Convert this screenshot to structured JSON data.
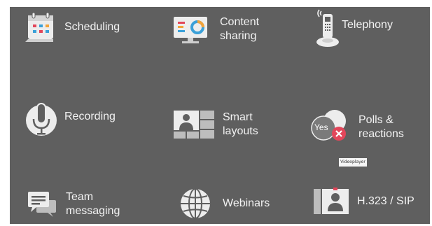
{
  "features": [
    {
      "id": "scheduling",
      "label": "Scheduling",
      "icon": "calendar-icon"
    },
    {
      "id": "content-sharing",
      "label": "Content\nsharing",
      "icon": "monitor-chart-icon"
    },
    {
      "id": "telephony",
      "label": "Telephony",
      "icon": "desk-phone-icon"
    },
    {
      "id": "recording",
      "label": "Recording",
      "icon": "microphone-icon"
    },
    {
      "id": "smart-layouts",
      "label": "Smart\nlayouts",
      "icon": "video-grid-icon"
    },
    {
      "id": "polls-reactions",
      "label": "Polls &\nreactions",
      "icon": "poll-bubble-icon",
      "icon_text": "Yes"
    },
    {
      "id": "team-messaging",
      "label": "Team\nmessaging",
      "icon": "chat-icon"
    },
    {
      "id": "webinars",
      "label": "Webinars",
      "icon": "globe-icon"
    },
    {
      "id": "h323-sip",
      "label": "H.323 / SIP",
      "icon": "conference-room-icon"
    }
  ],
  "badge_text": "Videoplayer",
  "colors": {
    "panel_bg": "#5f5f5f",
    "icon_light": "#ededed",
    "icon_mid": "#bdbdbd",
    "accent_red": "#e2465a",
    "accent_blue": "#3aa0d8",
    "accent_orange": "#f2a33a"
  }
}
